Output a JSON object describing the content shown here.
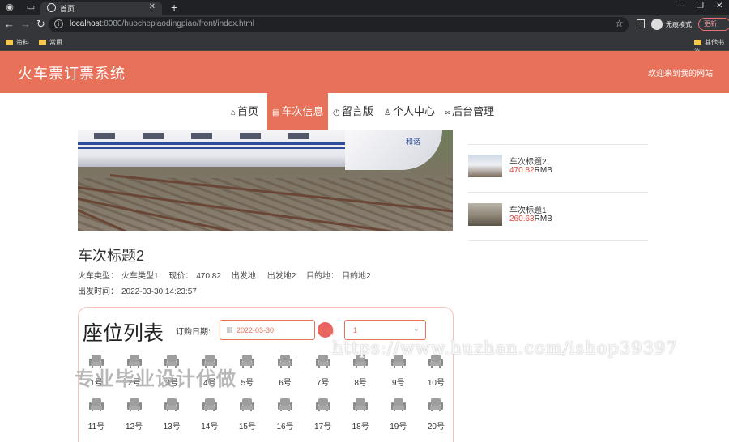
{
  "browser": {
    "tab_title": "首页",
    "address_host": "localhost",
    "address_path": ":8080/huochepiaodingpiao/front/index.html",
    "incognito_label": "无痕模式",
    "update_label": "更新",
    "bookmarks": [
      "资料",
      "常用",
      "其他书签"
    ]
  },
  "header": {
    "site_title": "火车票订票系统",
    "welcome": "欢迎来到我的网站"
  },
  "nav": {
    "items": [
      {
        "label": "首页",
        "icon": "home-icon"
      },
      {
        "label": "车次信息",
        "icon": "list-icon"
      },
      {
        "label": "留言版",
        "icon": "clock-icon"
      },
      {
        "label": "个人中心",
        "icon": "user-icon"
      },
      {
        "label": "后台管理",
        "icon": "link-icon"
      }
    ],
    "active": "车次信息"
  },
  "sidebar": {
    "items": [
      {
        "title": "车次标题2",
        "price": "470.82",
        "unit": "RMB"
      },
      {
        "title": "车次标题1",
        "price": "260.63",
        "unit": "RMB"
      }
    ]
  },
  "detail": {
    "title": "车次标题2",
    "train_type_label": "火车类型：",
    "train_type": "火车类型1",
    "price_label": "现价：",
    "price": "470.82",
    "from_label": "出发地：",
    "from": "出发地2",
    "to_label": "目的地：",
    "to": "目的地2",
    "depart_label": "出发时间：",
    "depart_time": "2022-03-30 14:23:57"
  },
  "seats": {
    "heading": "座位列表",
    "date_label": "订购日期:",
    "date_value": "2022-03-30",
    "car_label": "车厢:",
    "car_value": "1",
    "list": [
      "1号",
      "2号",
      "3号",
      "4号",
      "5号",
      "6号",
      "7号",
      "8号",
      "9号",
      "10号",
      "11号",
      "12号",
      "13号",
      "14号",
      "15号",
      "16号",
      "17号",
      "18号",
      "19号",
      "20号"
    ]
  },
  "watermarks": {
    "url": "https://www.huzhan.com/ishop39397",
    "text": "专业毕业设计代做"
  },
  "colors": {
    "accent": "#e8715a",
    "price": "#e0463a"
  }
}
